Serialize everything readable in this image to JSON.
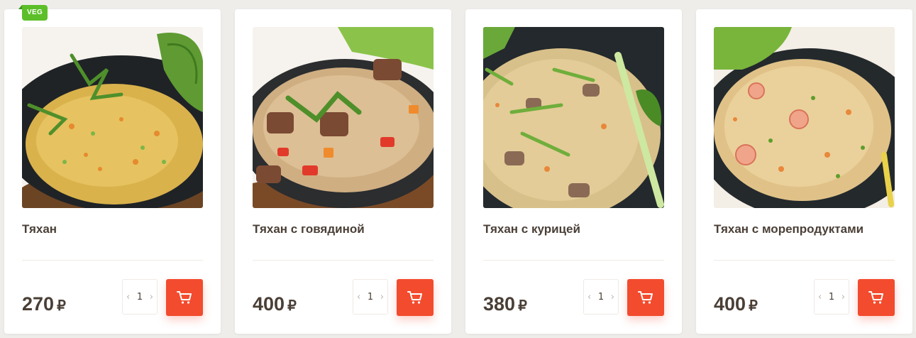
{
  "products": [
    {
      "name": "Тяхан",
      "price": "270",
      "currency": "₽",
      "quantity": "1",
      "badge": "VEG",
      "image_icon": "fried-rice-plate-image"
    },
    {
      "name": "Тяхан с говядиной",
      "price": "400",
      "currency": "₽",
      "quantity": "1",
      "image_icon": "fried-rice-beef-image"
    },
    {
      "name": "Тяхан с курицей",
      "price": "380",
      "currency": "₽",
      "quantity": "1",
      "image_icon": "fried-rice-chicken-image"
    },
    {
      "name": "Тяхан с морепродуктами",
      "price": "400",
      "currency": "₽",
      "quantity": "1",
      "image_icon": "fried-rice-seafood-image"
    }
  ],
  "qty_controls": {
    "decrease_glyph": "‹",
    "increase_glyph": "›"
  },
  "colors": {
    "accent": "#f34b2e",
    "veg_badge": "#5cbf2a",
    "text": "#4a3f36",
    "background": "#efedea"
  }
}
